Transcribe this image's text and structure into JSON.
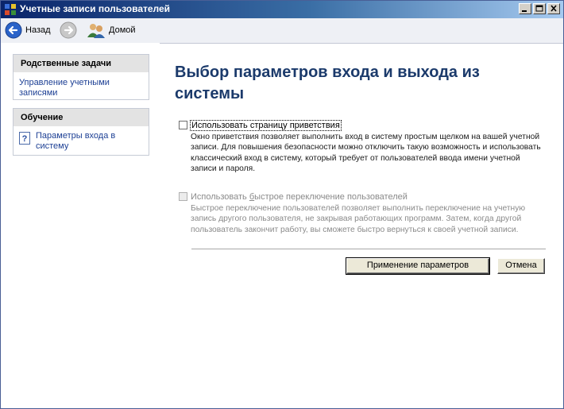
{
  "window": {
    "title": "Учетные записи пользователей",
    "controls": {
      "minimize": "minimize",
      "maximize": "maximize",
      "close": "close"
    }
  },
  "toolbar": {
    "back_label": "Назад",
    "home_label": "Домой"
  },
  "sidebar": {
    "related": {
      "header": "Родственные задачи",
      "links": [
        "Управление учетными записями"
      ]
    },
    "learn": {
      "header": "Обучение",
      "links": [
        "Параметры входа в систему"
      ]
    }
  },
  "main": {
    "title": "Выбор параметров входа и выхода из системы",
    "option1": {
      "checked": false,
      "enabled": true,
      "label": "Использовать страницу приветствия",
      "description": "Окно приветствия позволяет выполнить вход в систему простым щелком на вашей учетной записи. Для повышения безопасности можно отключить такую возможность и использовать классический вход в систему, который требует от пользователей ввода имени учетной записи и пароля."
    },
    "option2": {
      "checked": false,
      "enabled": false,
      "label_pre": "Использовать ",
      "label_ul": "б",
      "label_post": "ыстрое переключение пользователей",
      "description": "Быстрое переключение пользователей позволяет выполнить переключение на учетную запись другого пользователя, не закрывая работающих программ. Затем, когда другой пользователь закончит работу, вы сможете быстро вернуться к своей учетной записи."
    },
    "apply_button": "Применение параметров",
    "cancel_button": "Отмена"
  },
  "colors": {
    "title_color": "#1b3a6b",
    "link_color": "#1c3f94",
    "titlebar_start": "#0a246a"
  }
}
